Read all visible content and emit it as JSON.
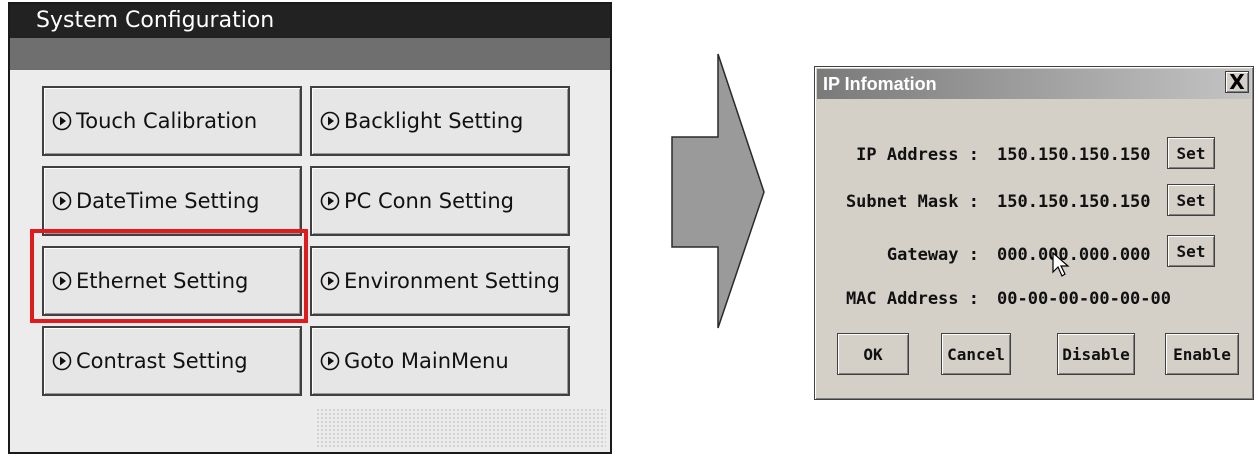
{
  "system_config": {
    "title": "System Configuration",
    "buttons": [
      {
        "label": "Touch Calibration"
      },
      {
        "label": "Backlight Setting"
      },
      {
        "label": "DateTime Setting"
      },
      {
        "label": "PC Conn Setting"
      },
      {
        "label": "Ethernet Setting"
      },
      {
        "label": "Environment Setting"
      },
      {
        "label": "Contrast Setting"
      },
      {
        "label": "Goto MainMenu"
      }
    ],
    "highlight_color": "#e01b1b"
  },
  "ip_dialog": {
    "title": "IP Infomation",
    "close_symbol": "X",
    "fields": [
      {
        "label": "IP Address :",
        "value": "150.150.150.150",
        "button": "Set"
      },
      {
        "label": "Subnet Mask :",
        "value": "150.150.150.150",
        "button": "Set"
      },
      {
        "label": "Gateway :",
        "value": "000.000.000.000",
        "button": "Set"
      },
      {
        "label": "MAC Address :",
        "value": "00-00-00-00-00-00"
      }
    ],
    "buttons": {
      "ok": "OK",
      "cancel": "Cancel",
      "disable": "Disable",
      "enable": "Enable"
    }
  },
  "icons": {
    "button_icon": "circle-play-icon",
    "flow_arrow": "right-arrow-icon",
    "cursor": "mouse-cursor-icon"
  }
}
